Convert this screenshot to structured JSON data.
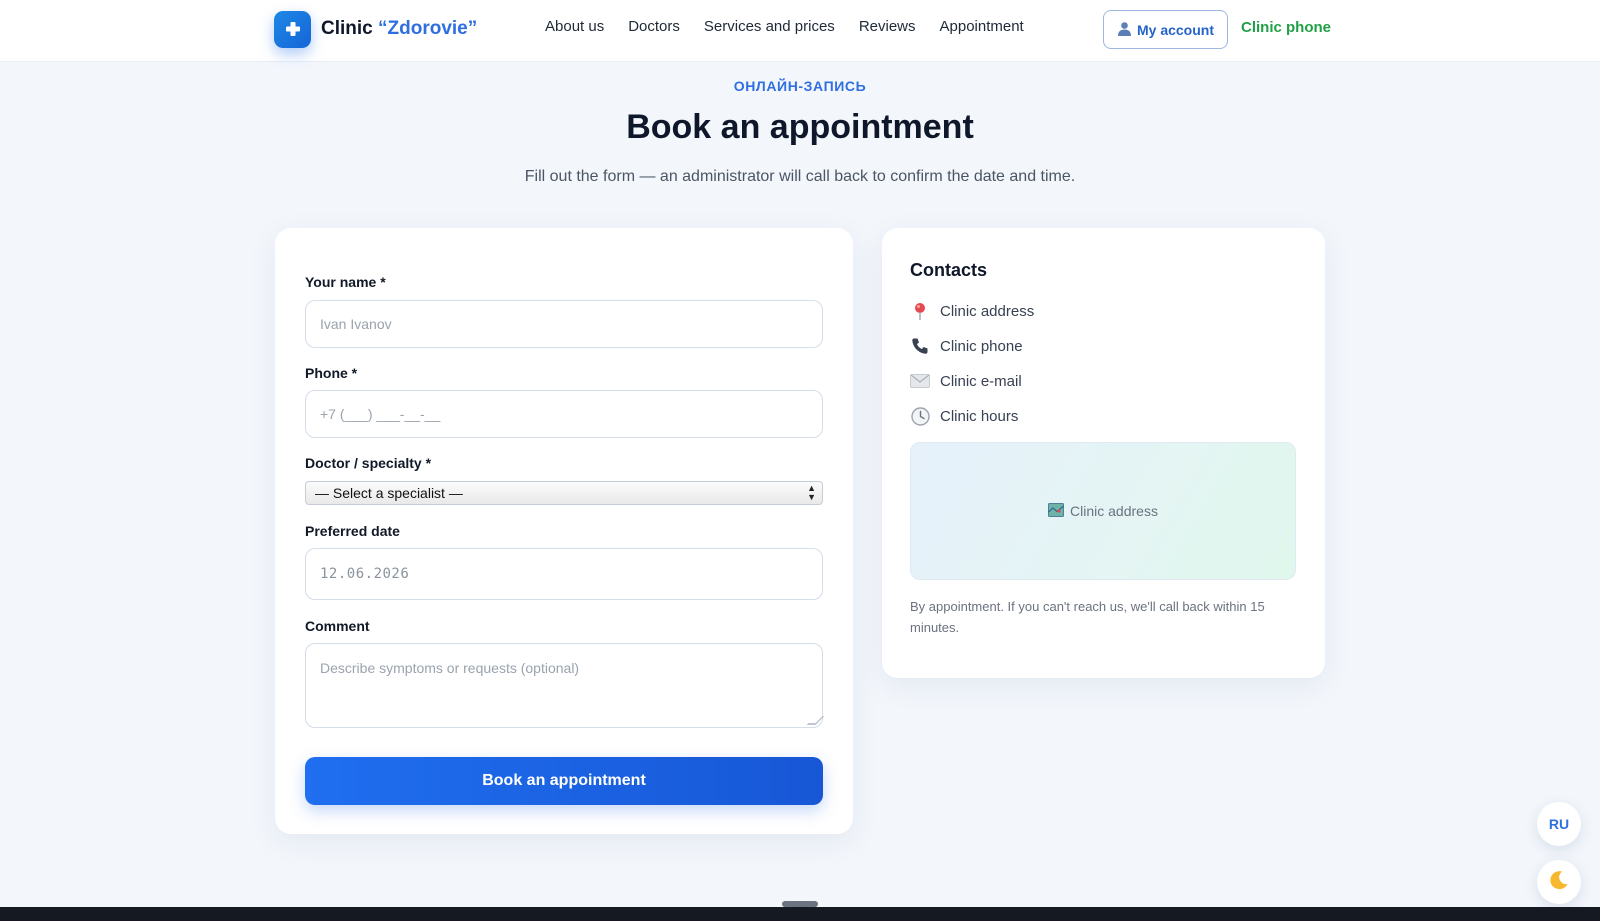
{
  "header": {
    "logo_prefix": "Clinic",
    "logo_brand": "“Zdorovie”",
    "nav": [
      "About us",
      "Doctors",
      "Services and prices",
      "Reviews",
      "Appointment"
    ],
    "account_label": "My account",
    "phone_label": "Clinic phone"
  },
  "hero": {
    "eyebrow": "ОНЛАЙН-ЗАПИСЬ",
    "title": "Book an appointment",
    "subtitle": "Fill out the form — an administrator will call back to confirm the date and time."
  },
  "form": {
    "name_label": "Your name *",
    "name_placeholder": "Ivan Ivanov",
    "phone_label": "Phone *",
    "phone_placeholder": "+7 (___) ___-__-__",
    "specialty_label": "Doctor / specialty *",
    "specialty_selected": "— Select a specialist —",
    "date_label": "Preferred date",
    "date_value": "12.06.2026",
    "comment_label": "Comment",
    "comment_placeholder": "Describe symptoms or requests (optional)",
    "submit_label": "Book an appointment"
  },
  "contacts": {
    "title": "Contacts",
    "items": [
      {
        "icon": "pin-icon",
        "label": "Clinic address"
      },
      {
        "icon": "phone-icon",
        "label": "Clinic phone"
      },
      {
        "icon": "envelope-icon",
        "label": "Clinic e-mail"
      },
      {
        "icon": "clock-icon",
        "label": "Clinic hours"
      }
    ],
    "map_label": "Clinic address",
    "note": "By appointment. If you can't reach us, we'll call back within 15 minutes."
  },
  "floating": {
    "lang_label": "RU"
  },
  "colors": {
    "accent": "#2f6fe0",
    "phone_green": "#22a046",
    "page_bg": "#f3f7fc"
  }
}
